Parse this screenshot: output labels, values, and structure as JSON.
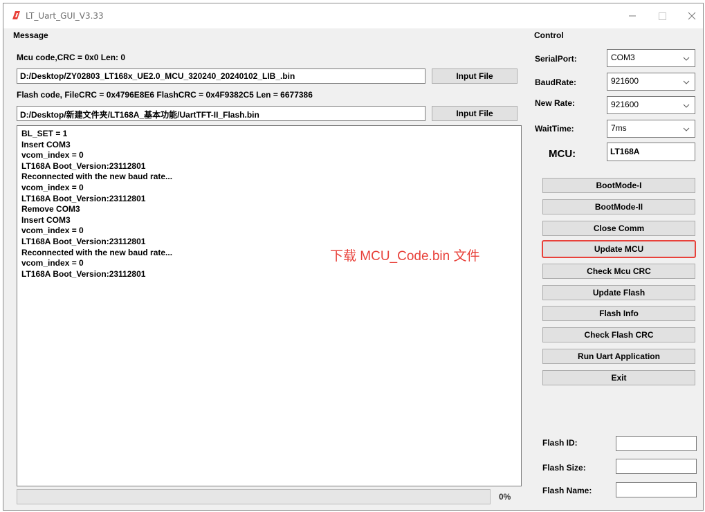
{
  "window": {
    "title": "LT_Uart_GUI_V3.33",
    "accent": "#e8413a"
  },
  "message": {
    "group_title": "Message",
    "mcu_info": "Mcu code,CRC = 0x0  Len: 0",
    "mcu_path": "D:/Desktop/ZY02803_LT168x_UE2.0_MCU_320240_20240102_LIB_.bin",
    "input_file_1": "Input File",
    "flash_info": "Flash code, FileCRC = 0x4796E8E6  FlashCRC = 0x4F9382C5  Len = 6677386",
    "flash_path": "D:/Desktop/新建文件夹/LT168A_基本功能/UartTFT-II_Flash.bin",
    "input_file_2": "Input File",
    "log": [
      "BL_SET = 1",
      "Insert COM3",
      "vcom_index = 0",
      "LT168A Boot_Version:23112801",
      "Reconnected with the new baud rate...",
      "vcom_index = 0",
      "LT168A Boot_Version:23112801",
      "Remove COM3",
      "Insert COM3",
      "vcom_index = 0",
      "LT168A Boot_Version:23112801",
      "Reconnected with the new baud rate...",
      "vcom_index = 0",
      "LT168A Boot_Version:23112801"
    ],
    "annotation": "下载 MCU_Code.bin 文件",
    "progress_value": 0,
    "progress_label": "0%"
  },
  "control": {
    "group_title": "Control",
    "serial_port_label": "SerialPort:",
    "serial_port_value": "COM3",
    "baud_rate_label": "BaudRate:",
    "baud_rate_value": "921600",
    "new_rate_label": "New Rate:",
    "new_rate_value": "921600",
    "wait_time_label": "WaitTime:",
    "wait_time_value": "7ms",
    "mcu_label": "MCU:",
    "mcu_value": "LT168A",
    "buttons": {
      "bootmode1": "BootMode-I",
      "bootmode2": "BootMode-II",
      "close_comm": "Close Comm",
      "update_mcu": "Update MCU",
      "check_mcu_crc": "Check Mcu CRC",
      "update_flash": "Update Flash",
      "flash_info": "Flash Info",
      "check_flash_crc": "Check Flash CRC",
      "run_uart_app": "Run Uart Application",
      "exit": "Exit"
    },
    "flash_id_label": "Flash ID:",
    "flash_id_value": "",
    "flash_size_label": "Flash Size:",
    "flash_size_value": "",
    "flash_name_label": "Flash Name:",
    "flash_name_value": ""
  }
}
